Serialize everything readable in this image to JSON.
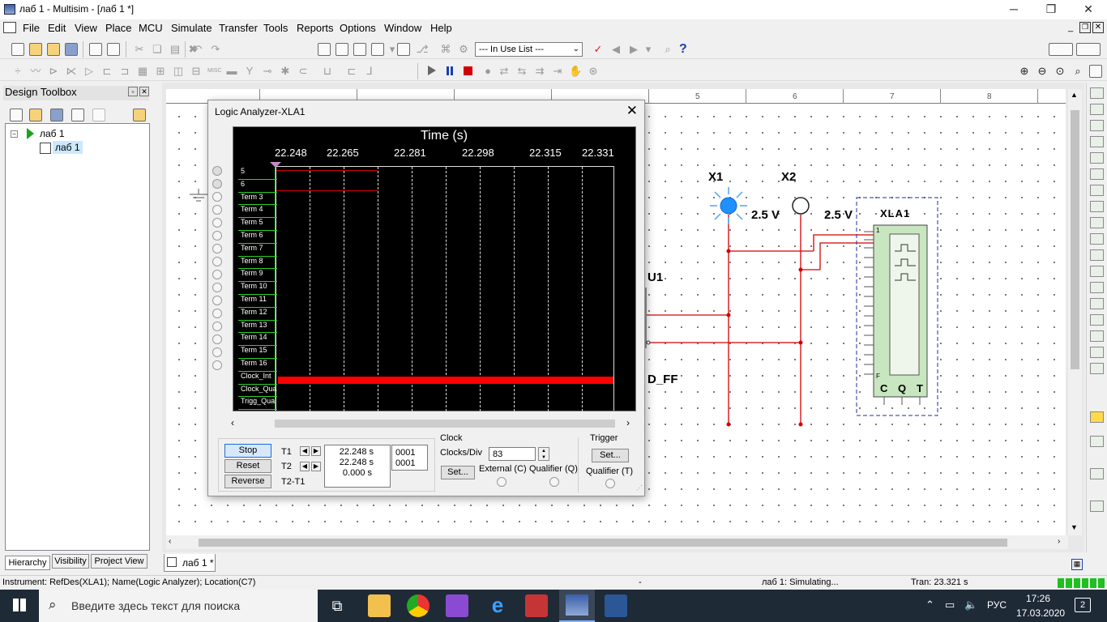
{
  "window": {
    "title": "лаб 1 - Multisim - [лаб 1 *]"
  },
  "menu": [
    "File",
    "Edit",
    "View",
    "Place",
    "MCU",
    "Simulate",
    "Transfer",
    "Tools",
    "Reports",
    "Options",
    "Window",
    "Help"
  ],
  "toolbar": {
    "in_use_list": "--- In Use List ---"
  },
  "design_toolbox": {
    "title": "Design Toolbox",
    "tree": [
      {
        "label": "лаб 1"
      },
      {
        "label": "лаб 1"
      }
    ],
    "tabs": [
      "Hierarchy",
      "Visibility",
      "Project View"
    ]
  },
  "ruler": {
    "labels": [
      "5",
      "6",
      "7",
      "8"
    ]
  },
  "doc_tab": "лаб 1 *",
  "schematic": {
    "x1_label": "X1",
    "x2_label": "X2",
    "x1_voltage": "2.5 V",
    "x2_voltage": "2.5 V",
    "xla1_label": "XLA1",
    "u1_label": "U1",
    "dff_label": "D_FF",
    "xla1_pin1": "1",
    "xla1_pinF": "F",
    "xla1_bottom": [
      "C",
      "Q",
      "T"
    ]
  },
  "logic_analyzer": {
    "title": "Logic Analyzer-XLA1",
    "time_header": "Time (s)",
    "time_ticks": [
      "22.248",
      "22.265",
      "22.281",
      "22.298",
      "22.315",
      "22.331"
    ],
    "channels": [
      "5",
      "6",
      "Term 3",
      "Term 4",
      "Term 5",
      "Term 6",
      "Term 7",
      "Term 8",
      "Term 9",
      "Term 10",
      "Term 11",
      "Term 12",
      "Term 13",
      "Term 14",
      "Term 15",
      "Term 16",
      "Clock_Int",
      "Clock_Qua",
      "Trigg_Qua"
    ],
    "buttons": {
      "stop": "Stop",
      "reset": "Reset",
      "reverse": "Reverse"
    },
    "t1_label": "T1",
    "t2_label": "T2",
    "t2t1_label": "T2-T1",
    "t1_value": "22.248 s",
    "t2_value": "22.248 s",
    "t2t1_value": "0.000 s",
    "t1_hex": "0001",
    "t2_hex": "0001",
    "clock": {
      "title": "Clock",
      "clocks_div_label": "Clocks/Div",
      "clocks_div_value": "83",
      "set": "Set...",
      "external": "External (C)",
      "qualifier": "Qualifier (Q)"
    },
    "trigger": {
      "title": "Trigger",
      "set": "Set...",
      "qualifier": "Qualifier (T)"
    }
  },
  "status": {
    "instrument": "Instrument: RefDes(XLA1); Name(Logic Analyzer); Location(C7)",
    "dash": "-",
    "simulating": "лаб 1: Simulating...",
    "tran": "Tran: 23.321 s"
  },
  "taskbar": {
    "search_placeholder": "Введите здесь текст для поиска",
    "lang": "РУС",
    "time": "17:26",
    "date": "17.03.2020",
    "notif_count": "2"
  }
}
